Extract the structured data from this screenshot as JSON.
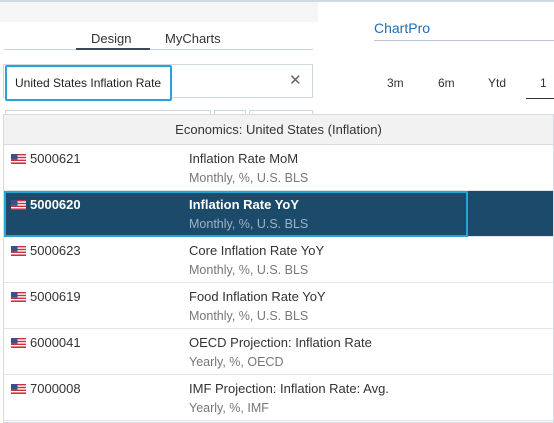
{
  "header": {
    "brand": "ChartPro",
    "ranges": [
      "3m",
      "6m",
      "Ytd",
      "1"
    ]
  },
  "panel": {
    "tabs": [
      "Design",
      "MyCharts"
    ],
    "active_tab": "Design",
    "search": {
      "value": "United States Inflation Rate",
      "clear_icon": "close-icon"
    }
  },
  "dropdown": {
    "header": "Economics: United States (Inflation)",
    "selected_index": 1,
    "items": [
      {
        "code": "5000621",
        "name": "Inflation Rate MoM",
        "meta": "Monthly, %, U.S. BLS"
      },
      {
        "code": "5000620",
        "name": "Inflation Rate YoY",
        "meta": "Monthly, %, U.S. BLS"
      },
      {
        "code": "5000623",
        "name": "Core Inflation Rate YoY",
        "meta": "Monthly, %, U.S. BLS"
      },
      {
        "code": "5000619",
        "name": "Food Inflation Rate YoY",
        "meta": "Monthly, %, U.S. BLS"
      },
      {
        "code": "6000041",
        "name": "OECD Projection: Inflation Rate",
        "meta": "Yearly, %, OECD"
      },
      {
        "code": "7000008",
        "name": "IMF Projection: Inflation Rate: Avg.",
        "meta": "Yearly, %, IMF"
      }
    ]
  },
  "colors": {
    "accent": "#27a3d9",
    "selected_row": "#1b4a6b",
    "brand": "#1f6fb2"
  }
}
